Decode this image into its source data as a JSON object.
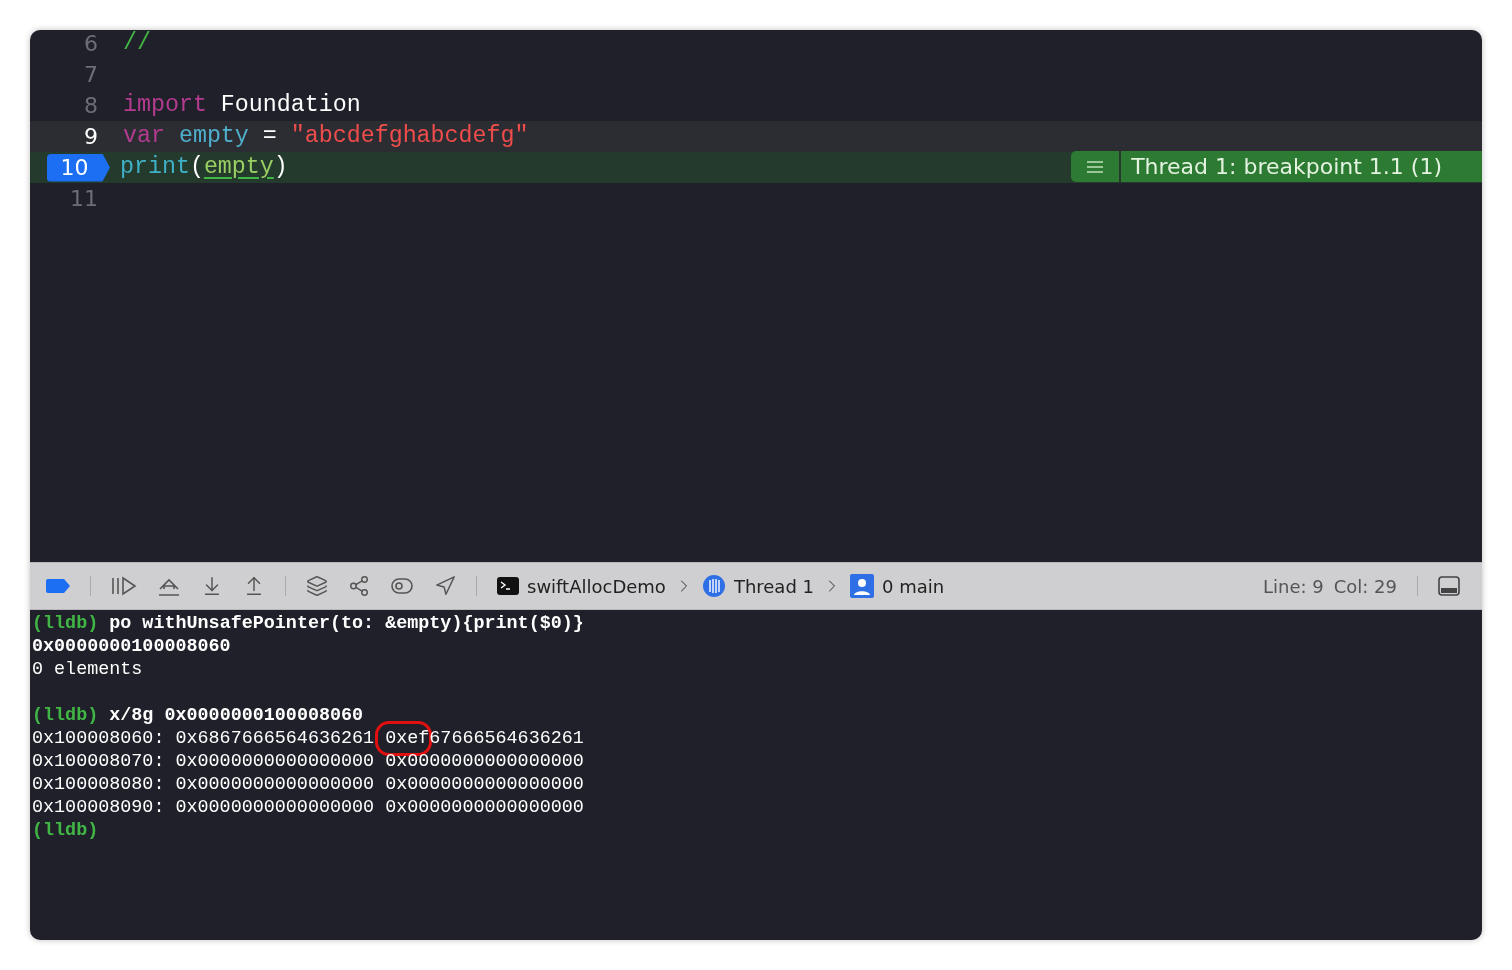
{
  "editor": {
    "lines": [
      {
        "number": "6",
        "current": false,
        "stopped": false,
        "breakpoint": false,
        "tokens": [
          {
            "kind": "comment",
            "text": "//"
          }
        ]
      },
      {
        "number": "7",
        "current": false,
        "stopped": false,
        "breakpoint": false
      },
      {
        "number": "8",
        "current": false,
        "stopped": false,
        "breakpoint": false,
        "tokens": [
          {
            "kind": "keyword",
            "text": "import"
          },
          {
            "kind": "plain",
            "text": " Foundation"
          }
        ]
      },
      {
        "number": "9",
        "current": true,
        "stopped": false,
        "breakpoint": false,
        "tokens": [
          {
            "kind": "keyword",
            "text": "var"
          },
          {
            "kind": "identifier",
            "text": " empty"
          },
          {
            "kind": "plain",
            "text": " = "
          },
          {
            "kind": "string",
            "text": "\"abcdefghabcdefg\""
          }
        ]
      },
      {
        "number": "10",
        "current": false,
        "stopped": true,
        "breakpoint": true,
        "tokens": [
          {
            "kind": "function",
            "text": "print"
          },
          {
            "kind": "plain",
            "text": "("
          },
          {
            "kind": "reference",
            "text": "empty"
          },
          {
            "kind": "plain",
            "text": ")"
          }
        ],
        "annotation": "Thread 1: breakpoint 1.1 (1)"
      },
      {
        "number": "11",
        "current": false,
        "stopped": false,
        "breakpoint": false
      }
    ]
  },
  "debug_bar": {
    "breakpoints_active": true,
    "breadcrumbs": [
      {
        "kind": "app",
        "label": "swiftAllocDemo"
      },
      {
        "kind": "thread",
        "label": "Thread 1"
      },
      {
        "kind": "frame",
        "label": "0 main"
      }
    ],
    "line": "Line: 9",
    "col": "Col: 29"
  },
  "console": {
    "lines": [
      {
        "prompt": "(lldb)",
        "gap_before": false,
        "bold": true,
        "segments": [
          {
            "text": "po withUnsafePointer(to: &empty){print($0)}",
            "circled": false
          }
        ]
      },
      {
        "gap_before": false,
        "bold": true,
        "segments": [
          {
            "text": "0x0000000100008060",
            "circled": false
          }
        ]
      },
      {
        "gap_before": false,
        "bold": false,
        "segments": [
          {
            "text": "0 elements",
            "circled": false
          }
        ]
      },
      {
        "prompt": "(lldb)",
        "gap_before": true,
        "bold": true,
        "segments": [
          {
            "text": "x/8g 0x0000000100008060",
            "circled": false
          }
        ]
      },
      {
        "gap_before": false,
        "bold": false,
        "segments": [
          {
            "text": "0x100008060: 0x6867666564636261 ",
            "circled": false
          },
          {
            "text": "0xef",
            "circled": true
          },
          {
            "text": "67666564636261",
            "circled": false
          }
        ]
      },
      {
        "gap_before": false,
        "bold": false,
        "segments": [
          {
            "text": "0x100008070: 0x0000000000000000 0x0000000000000000",
            "circled": false
          }
        ]
      },
      {
        "gap_before": false,
        "bold": false,
        "segments": [
          {
            "text": "0x100008080: 0x0000000000000000 0x0000000000000000",
            "circled": false
          }
        ]
      },
      {
        "gap_before": false,
        "bold": false,
        "segments": [
          {
            "text": "0x100008090: 0x0000000000000000 0x0000000000000000",
            "circled": false
          }
        ]
      },
      {
        "prompt": "(lldb)",
        "gap_before": false
      }
    ]
  }
}
